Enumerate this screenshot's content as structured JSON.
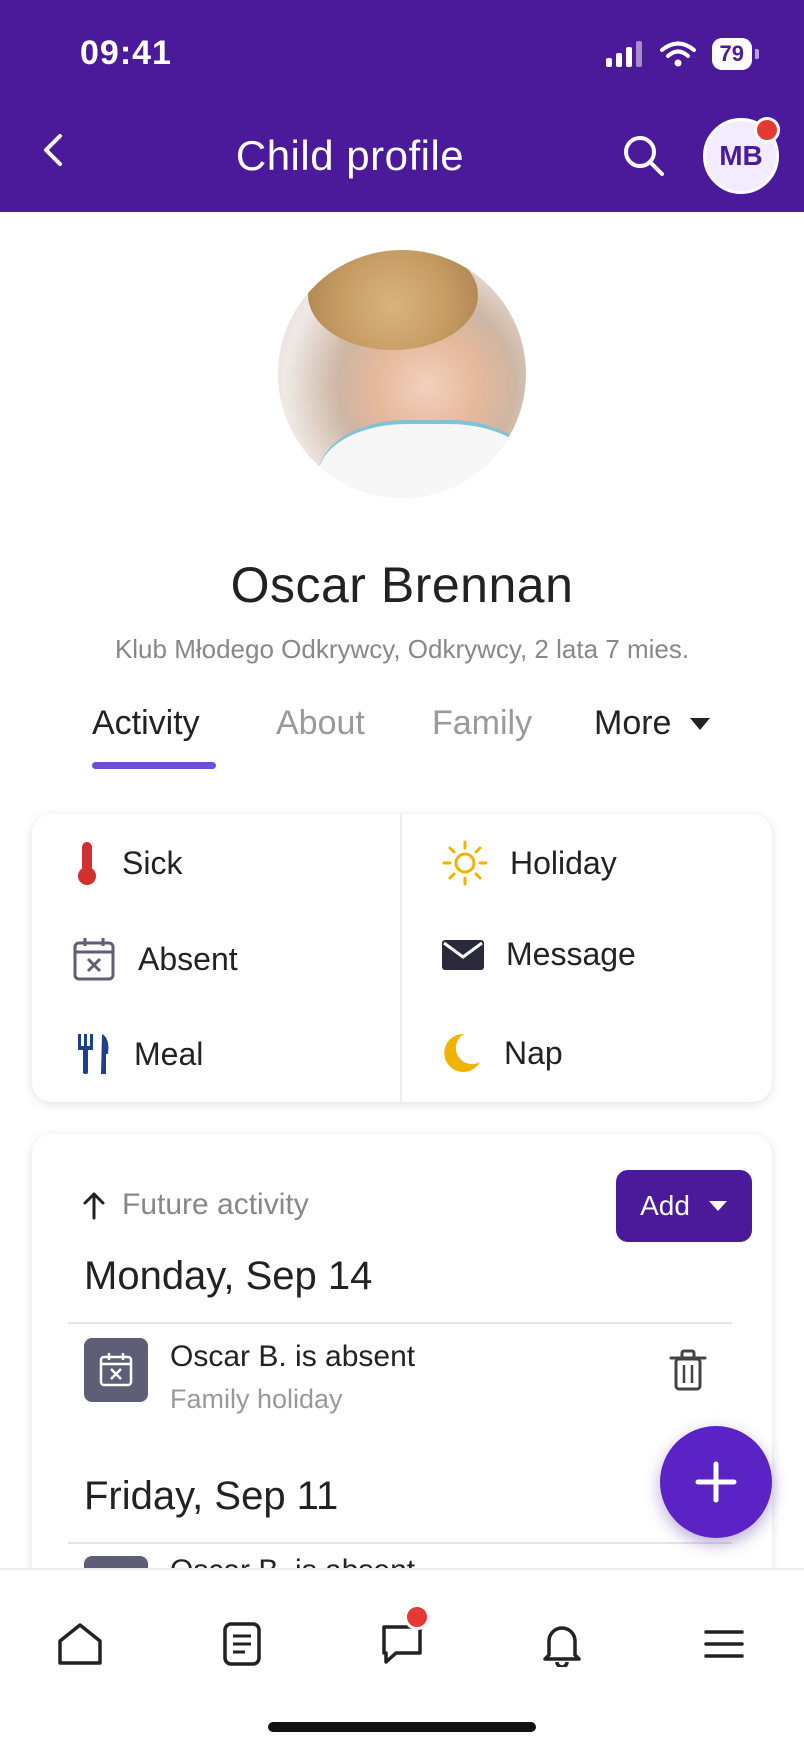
{
  "status_bar": {
    "time": "09:41",
    "battery": "79"
  },
  "header": {
    "title": "Child profile",
    "avatar_initials": "MB"
  },
  "profile": {
    "name": "Oscar Brennan",
    "subtitle": "Klub Młodego Odkrywcy, Odkrywcy, 2 lata 7 mies."
  },
  "tabs": [
    {
      "label": "Activity",
      "active": true
    },
    {
      "label": "About",
      "active": false
    },
    {
      "label": "Family",
      "active": false
    },
    {
      "label": "More",
      "active": false
    }
  ],
  "quick_actions": [
    {
      "label": "Sick",
      "icon": "thermometer-icon"
    },
    {
      "label": "Holiday",
      "icon": "sun-icon"
    },
    {
      "label": "Absent",
      "icon": "calendar-x-icon"
    },
    {
      "label": "Message",
      "icon": "envelope-icon"
    },
    {
      "label": "Meal",
      "icon": "fork-knife-icon"
    },
    {
      "label": "Nap",
      "icon": "moon-icon"
    }
  ],
  "activity": {
    "section_label": "Future activity",
    "add_label": "Add",
    "days": [
      {
        "heading": "Monday, Sep 14",
        "events": [
          {
            "title": "Oscar B. is absent",
            "subtitle": "Family holiday"
          }
        ]
      },
      {
        "heading": "Friday, Sep 11",
        "events": [
          {
            "title": "Oscar B. is absent",
            "subtitle": ""
          }
        ]
      }
    ]
  },
  "colors": {
    "brand": "#4a1a9b",
    "accent": "#6a4fd1",
    "fab": "#5b22c5",
    "notification": "#e53935",
    "sun": "#f0b400",
    "thermometer": "#d32f2f",
    "meal": "#1e3f8c"
  },
  "bottom_nav": [
    {
      "icon": "home-icon"
    },
    {
      "icon": "document-icon"
    },
    {
      "icon": "chat-icon",
      "has_badge": true
    },
    {
      "icon": "bell-icon"
    },
    {
      "icon": "menu-icon"
    }
  ]
}
